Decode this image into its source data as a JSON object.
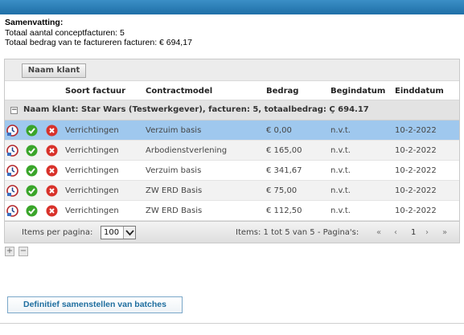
{
  "summary": {
    "title": "Samenvatting:",
    "total_concepts": "Totaal aantal conceptfacturen: 5",
    "total_amount": "Totaal bedrag van te factureren facturen: € 694,17"
  },
  "grid": {
    "group_chip": "Naam klant",
    "columns": [
      "Soort factuur",
      "Contractmodel",
      "Bedrag",
      "Begindatum",
      "Einddatum"
    ],
    "group_row": {
      "expander": "−",
      "label": "Naam klant: Star Wars (Testwerkgever), facturen: 5, totaalbedrag: Ç 694.17"
    },
    "rows": [
      {
        "soort": "Verrichtingen",
        "contract": "Verzuim basis",
        "bedrag": "€ 0,00",
        "begin": "n.v.t.",
        "eind": "10-2-2022"
      },
      {
        "soort": "Verrichtingen",
        "contract": "Arbodienstverlening",
        "bedrag": "€ 165,00",
        "begin": "n.v.t.",
        "eind": "10-2-2022"
      },
      {
        "soort": "Verrichtingen",
        "contract": "Verzuim basis",
        "bedrag": "€ 341,67",
        "begin": "n.v.t.",
        "eind": "10-2-2022"
      },
      {
        "soort": "Verrichtingen",
        "contract": "ZW ERD Basis",
        "bedrag": "€ 75,00",
        "begin": "n.v.t.",
        "eind": "10-2-2022"
      },
      {
        "soort": "Verrichtingen",
        "contract": "ZW ERD Basis",
        "bedrag": "€ 112,50",
        "begin": "n.v.t.",
        "eind": "10-2-2022"
      }
    ],
    "pager": {
      "items_per_page_label": "Items per pagina:",
      "page_size": "100",
      "items_info": "Items: 1 tot 5 van 5 - Pagina's:",
      "first": "«",
      "prev": "‹",
      "current_page": "1",
      "next": "›",
      "last": "»"
    }
  },
  "mini_buttons": {
    "expand": "+",
    "collapse": "−"
  },
  "actions": {
    "finalize": "Definitief samenstellen van batches"
  },
  "colors": {
    "header_blue": "#1f6fa7",
    "selected_row": "#9fc8ee",
    "button_text": "#1f6e9f",
    "clock_icon": "#b3262b",
    "check_icon": "#3aa52a",
    "delete_icon": "#d8322b"
  }
}
